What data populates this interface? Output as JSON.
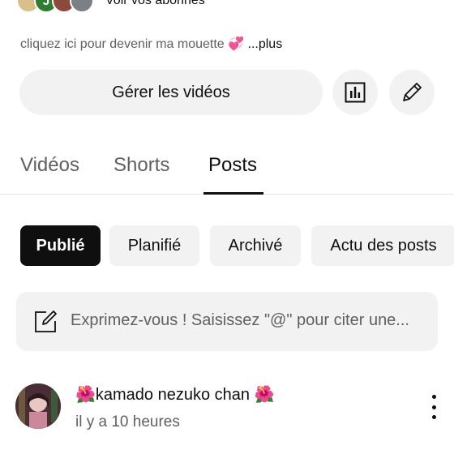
{
  "subscribers": {
    "avatar_letters": [
      "",
      "J",
      "",
      ""
    ],
    "link_label": "Voir vos abonnés"
  },
  "bio": {
    "text": "cliquez ici pour devenir ma mouette",
    "emoji": "💞",
    "more_label": "...plus"
  },
  "actions": {
    "manage_videos_label": "Gérer les vidéos",
    "stats_icon": "analytics-icon",
    "edit_icon": "pencil-icon"
  },
  "tabs": [
    {
      "label": "Vidéos",
      "selected": false
    },
    {
      "label": "Shorts",
      "selected": false
    },
    {
      "label": "Posts",
      "selected": true
    }
  ],
  "chips": [
    {
      "label": "Publié",
      "selected": true
    },
    {
      "label": "Planifié",
      "selected": false
    },
    {
      "label": "Archivé",
      "selected": false
    },
    {
      "label": "Actu des posts",
      "selected": false
    }
  ],
  "compose": {
    "placeholder": "Exprimez-vous ! Saisissez \"@\" pour citer une...",
    "icon": "compose-icon"
  },
  "post": {
    "author": "🌺kamado nezuko chan 🌺",
    "time": "il y a 10 heures",
    "menu_icon": "more-vertical-icon"
  },
  "colors": {
    "text_primary": "#0f0f0f",
    "text_secondary": "#606060",
    "chip_bg": "#f2f2f2",
    "chip_active_bg": "#0f0f0f"
  }
}
